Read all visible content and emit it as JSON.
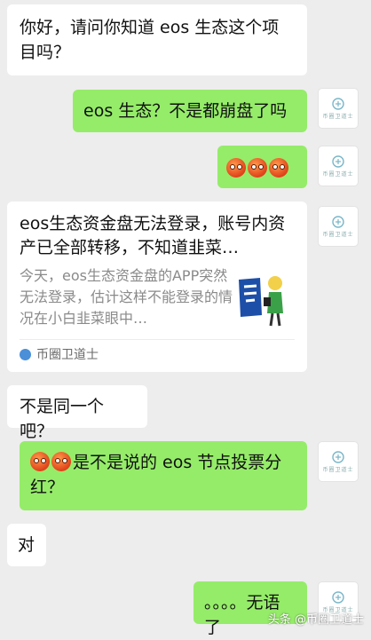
{
  "messages": [
    {
      "side": "left",
      "text": "你好，请问你知道 eos 生态这个项目吗？"
    },
    {
      "side": "right",
      "text": "eos 生态？不是都崩盘了吗"
    },
    {
      "side": "right",
      "emoji_count": 3
    },
    {
      "side": "left",
      "type": "link_card",
      "title": "eos生态资金盘无法登录，账号内资产已全部转移，不知道韭菜…",
      "description": "今天，eos生态资金盘的APP突然无法登录，估计这样不能登录的情况在小白韭菜眼中…",
      "source": "币圈卫道士"
    },
    {
      "side": "left",
      "text": "不是同一个吧？"
    },
    {
      "side": "right",
      "text": "是不是说的 eos 节点投票分红？",
      "emoji_count": 2
    },
    {
      "side": "left",
      "text": "对"
    },
    {
      "side": "right",
      "text": "。。。。无语了"
    }
  ],
  "avatar_caption": "币圈卫道士",
  "watermark": "头条 @币圈卫道士",
  "colors": {
    "background": "#ededed",
    "sent_bubble": "#95ec69",
    "received_bubble": "#ffffff"
  }
}
